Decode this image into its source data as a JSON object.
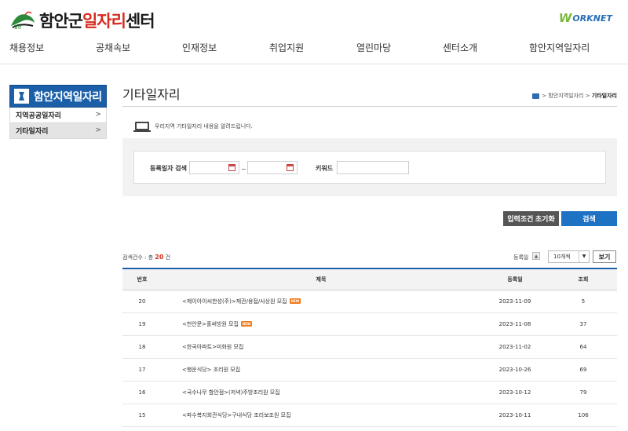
{
  "header": {
    "logo_small": "함안",
    "logo_prefix": "함안군",
    "logo_red": "일자리",
    "logo_suffix": "센터",
    "worknet_w": "W",
    "worknet_rest": "ORKNET"
  },
  "nav": [
    "채용정보",
    "공채속보",
    "인재정보",
    "취업지원",
    "열린마당",
    "센터소개",
    "함안지역일자리"
  ],
  "sidebar": {
    "title": "함안지역일자리",
    "items": [
      {
        "label": "지역공공일자리",
        "active": false
      },
      {
        "label": "기타일자리",
        "active": true
      }
    ]
  },
  "page": {
    "title": "기타일자리",
    "breadcrumb_path": "> 함안지역일자리 >",
    "breadcrumb_current": "기타일자리",
    "intro": "우리지역 기타일자리 내용을 알려드립니다."
  },
  "search": {
    "date_label": "등록일자 검색",
    "tilde": "~",
    "keyword_label": "키워드",
    "date_from": "",
    "date_to": "",
    "keyword": "",
    "reset_label": "입력조건 초기화",
    "search_label": "검색"
  },
  "list_meta": {
    "count_prefix": "검색건수 : 총",
    "count": "20",
    "count_suffix": "건",
    "sort_label": "등록일",
    "sort_arrow": "▲",
    "page_size": "10개씩",
    "view_label": "보기"
  },
  "table": {
    "columns": [
      "번호",
      "제목",
      "등록일",
      "조회"
    ],
    "new_label": "NEW",
    "rows": [
      {
        "no": "20",
        "title": "<제이아이씨한성(주)>제관/용접/사상원 모집",
        "new": true,
        "date": "2023-11-09",
        "views": "5"
      },
      {
        "no": "19",
        "title": "<천안문>홀써빙원 모집",
        "new": true,
        "date": "2023-11-08",
        "views": "37"
      },
      {
        "no": "18",
        "title": "<한국아파트>미화원 모집",
        "new": false,
        "date": "2023-11-02",
        "views": "64"
      },
      {
        "no": "17",
        "title": "<행운식당> 조리원 모집",
        "new": false,
        "date": "2023-10-26",
        "views": "69"
      },
      {
        "no": "16",
        "title": "<국수나무 함안점>(저녁)주방조리원 모집",
        "new": false,
        "date": "2023-10-12",
        "views": "79"
      },
      {
        "no": "15",
        "title": "<파수복지회관식당>구내식당 조리보조원 모집",
        "new": false,
        "date": "2023-10-11",
        "views": "106"
      }
    ]
  },
  "colors": {
    "brand_blue": "#1b5fa9",
    "accent_red": "#d72b1f",
    "search_blue": "#1e72c4",
    "new_orange": "#f07d1e"
  }
}
